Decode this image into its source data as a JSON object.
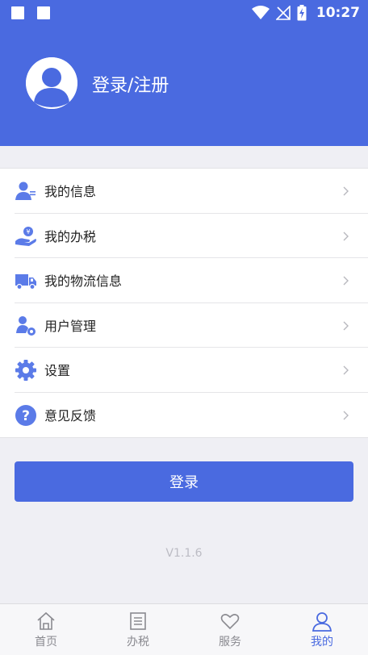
{
  "status_bar": {
    "time": "10:27",
    "icons": [
      "notification-square-icon",
      "notification-square-icon",
      "wifi-icon",
      "no-signal-icon",
      "battery-charging-icon"
    ]
  },
  "header": {
    "title": "登录/注册",
    "avatar_icon": "user-avatar-icon"
  },
  "menu": {
    "items": [
      {
        "label": "我的信息",
        "icon": "user-info-icon"
      },
      {
        "label": "我的办税",
        "icon": "tax-hand-icon"
      },
      {
        "label": "我的物流信息",
        "icon": "truck-icon"
      },
      {
        "label": "用户管理",
        "icon": "user-settings-icon"
      },
      {
        "label": "设置",
        "icon": "gear-icon"
      },
      {
        "label": "意见反馈",
        "icon": "question-icon"
      }
    ]
  },
  "login_button": "登录",
  "version": "V1.1.6",
  "tabbar": {
    "tabs": [
      {
        "label": "首页",
        "icon": "home-icon",
        "active": false
      },
      {
        "label": "办税",
        "icon": "list-icon",
        "active": false
      },
      {
        "label": "服务",
        "icon": "heart-icon",
        "active": false
      },
      {
        "label": "我的",
        "icon": "user-icon",
        "active": true
      }
    ]
  },
  "colors": {
    "accent": "#4a6ae0",
    "icon_blue": "#5b7be8",
    "background": "#efeff4"
  }
}
